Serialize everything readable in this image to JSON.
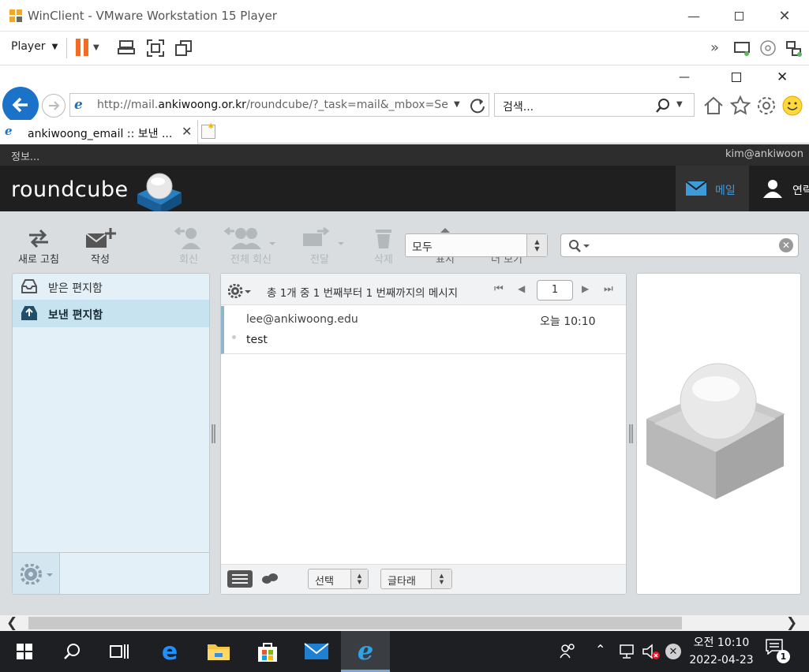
{
  "vmware": {
    "title": "WinClient - VMware Workstation 15 Player",
    "player_menu": "Player"
  },
  "ie": {
    "url_prefix": "http://mail.",
    "url_domain": "ankiwoong.or.kr",
    "url_rest": "/roundcube/?_task=mail&_mbox=Sen",
    "search_placeholder": "검색...",
    "tab_title": "ankiwoong_email :: 보낸 ..."
  },
  "roundcube": {
    "info_link": "정보...",
    "user_email": "kim@ankiwoon",
    "logo_text": "roundcube",
    "nav_mail": "메일",
    "nav_contacts": "연락",
    "toolbar": {
      "refresh": "새로 고침",
      "compose": "작성",
      "reply": "회신",
      "reply_all": "전체 회신",
      "forward": "전달",
      "delete": "삭제",
      "mark": "표시",
      "more": "더 보기"
    },
    "filter_value": "모두",
    "folders": [
      {
        "label": "받은 편지함",
        "selected": false
      },
      {
        "label": "보낸 편지함",
        "selected": true
      }
    ],
    "list_header": "총 1개 중 1 번째부터 1 번째까지의 메시지",
    "page_number": "1",
    "messages": [
      {
        "to": "lee@ankiwoong.edu",
        "date": "오늘 10:10",
        "subject": "test"
      }
    ],
    "footer_select": "선택",
    "footer_threads": "글타래"
  },
  "taskbar": {
    "time": "오전 10:10",
    "date": "2022-04-23",
    "notification_count": "1"
  }
}
